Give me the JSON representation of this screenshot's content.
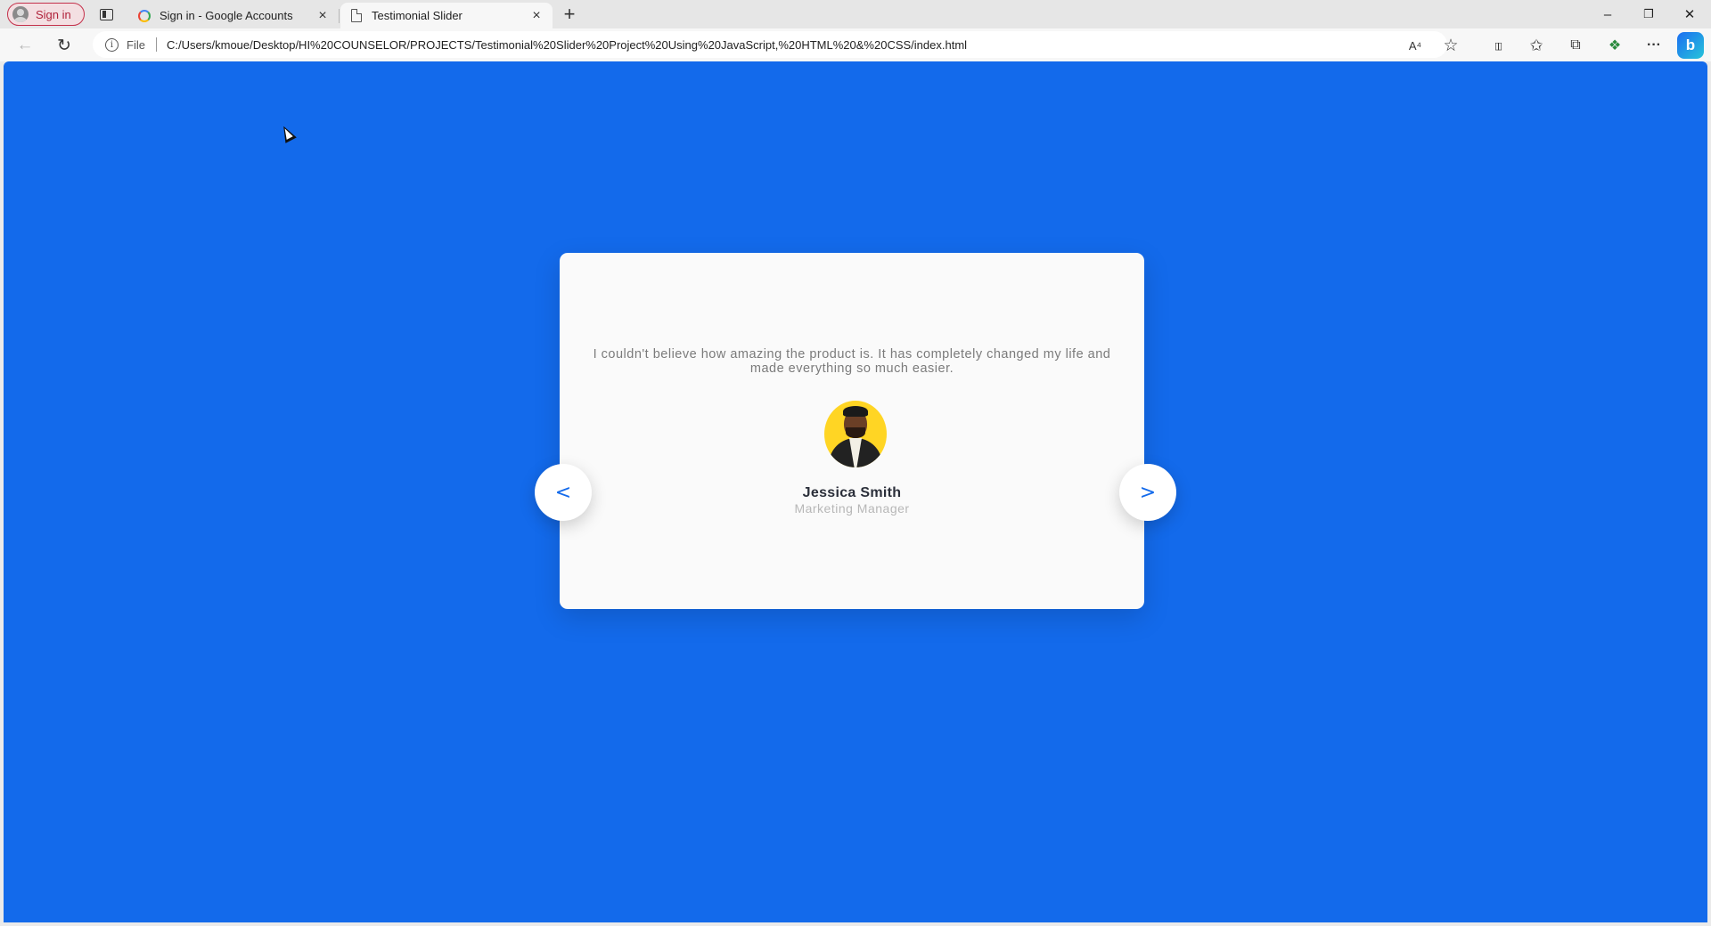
{
  "browser": {
    "profile_label": "Sign in",
    "tabs": [
      {
        "title": "Sign in - Google Accounts",
        "icon": "google-icon",
        "active": false
      },
      {
        "title": "Testimonial Slider",
        "icon": "page-icon",
        "active": true
      }
    ],
    "new_tab_glyph": "+",
    "close_glyph": "×",
    "window_controls": {
      "minimize": "–",
      "restore": "❐",
      "close": "✕"
    },
    "nav": {
      "back": "←",
      "reload": "↻"
    },
    "address": {
      "scheme_label": "File",
      "url": "C:/Users/kmoue/Desktop/HI%20COUNSELOR/PROJECTS/Testimonial%20Slider%20Project%20Using%20JavaScript,%20HTML%20&%20CSS/index.html"
    },
    "toolbar_icons": {
      "read_aloud": "A⁴",
      "favorite": "☆",
      "split_screen": "▯▯",
      "favorites": "✩",
      "collections": "⧉",
      "extensions": "❖",
      "more": "···",
      "copilot": "b"
    }
  },
  "page": {
    "background_color": "#136aeb",
    "testimonial": {
      "quote": "I couldn't believe how amazing the product is. It has completely changed my life and made everything so much easier.",
      "name": "Jessica Smith",
      "role": "Marketing Manager"
    },
    "prev_label": "<",
    "next_label": ">"
  }
}
